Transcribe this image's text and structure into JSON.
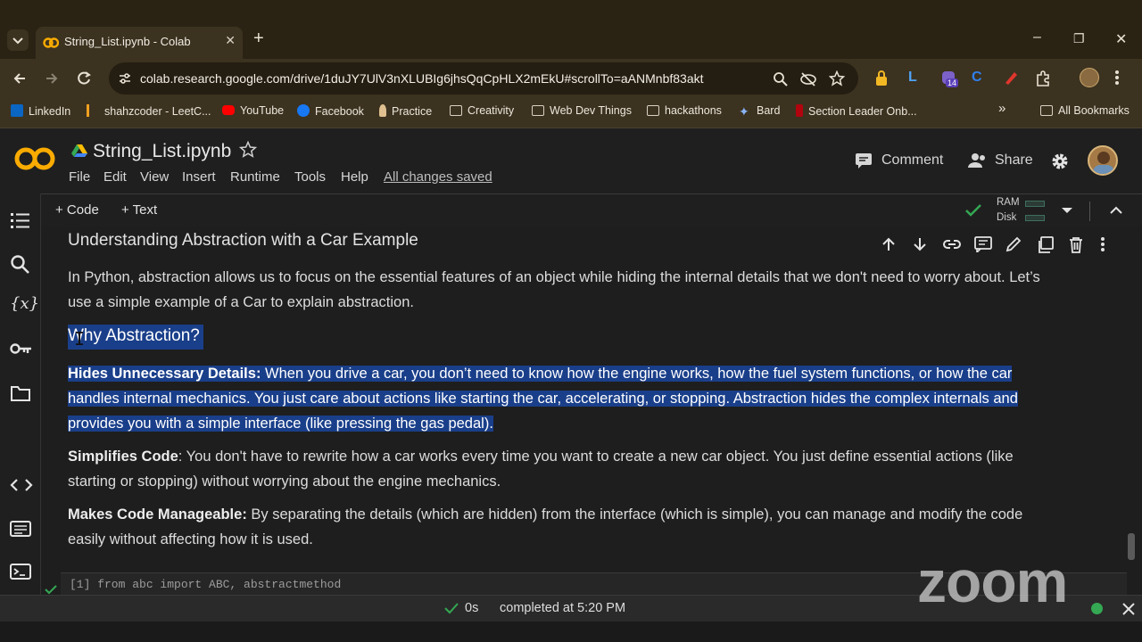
{
  "browser": {
    "tab_title": "String_List.ipynb - Colab",
    "tab_close": "✕",
    "new_tab": "+",
    "url": "colab.research.google.com/drive/1duJY7UlV3nXLUBIg6jhsQqCpHLX2mEkU#scrollTo=aANMnbf83akt",
    "extension_badge": "14",
    "window_controls": {
      "minimize": "–",
      "restore": "❐",
      "close": "✕"
    }
  },
  "bookmarks": {
    "items": [
      {
        "label": "LinkedIn",
        "icon": "linkedin-icon",
        "color": "#0a66c2"
      },
      {
        "label": "shahzcoder - LeetC...",
        "icon": "leetcode-icon",
        "color": "#f0a020"
      },
      {
        "label": "YouTube",
        "icon": "youtube-icon",
        "color": "#ff0000"
      },
      {
        "label": "Facebook",
        "icon": "facebook-icon",
        "color": "#1877f2"
      },
      {
        "label": "Practice",
        "icon": "practice-icon",
        "color": "#e0c090"
      },
      {
        "label": "Creativity",
        "icon": "folder-icon",
        "color": "#d8d2c4"
      },
      {
        "label": "Web Dev Things",
        "icon": "folder-icon",
        "color": "#d8d2c4"
      },
      {
        "label": "hackathons",
        "icon": "folder-icon",
        "color": "#d8d2c4"
      },
      {
        "label": "Bard",
        "icon": "bard-icon",
        "color": "#8ab4f8"
      },
      {
        "label": "Section Leader Onb...",
        "icon": "stanford-icon",
        "color": "#b1040e"
      }
    ],
    "overflow": "»",
    "all_bookmarks": "All Bookmarks"
  },
  "colab": {
    "logo": "CO",
    "filename": "String_List.ipynb",
    "menu": [
      "File",
      "Edit",
      "View",
      "Insert",
      "Runtime",
      "Tools",
      "Help"
    ],
    "saved_status": "All changes saved",
    "comment": "Comment",
    "share": "Share",
    "add_code": "+ Code",
    "add_text": "+ Text",
    "ram": "RAM",
    "disk": "Disk"
  },
  "content": {
    "heading": "Understanding Abstraction with a Car Example",
    "intro": "In Python, abstraction allows us to focus on the essential features of an object while hiding the internal details that we don't need to worry about. Let’s use a simple example of a Car to explain abstraction.",
    "why_heading": "Why Abstraction?",
    "points": [
      {
        "title": "Hides Unnecessary Details:",
        "text": " When you drive a car, you don’t need to know how the engine works, how the fuel system functions, or how the car handles internal mechanics. You just care about actions like starting the car, accelerating, or stopping. Abstraction hides the complex internals and provides you with a simple interface (like pressing the gas pedal)."
      },
      {
        "title": "Simplifies Code",
        "text": ": You don't have to rewrite how a car works every time you want to create a new car object. You just define essential actions (like starting or stopping) without worrying about the engine mechanics."
      },
      {
        "title": "Makes Code Manageable:",
        "text": " By separating the details (which are hidden) from the interface (which is simple), you can manage and modify the code easily without affecting how it is used."
      }
    ],
    "code_preview": "[1]  from abc import ABC, abstractmethod"
  },
  "status": {
    "duration": "0s",
    "completed": "completed at 5:20 PM"
  },
  "overlay": {
    "watermark": "zoom"
  },
  "colors": {
    "accent_orange": "#f9ab00",
    "selection_blue": "#1a3f8a",
    "check_green": "#34a853"
  }
}
